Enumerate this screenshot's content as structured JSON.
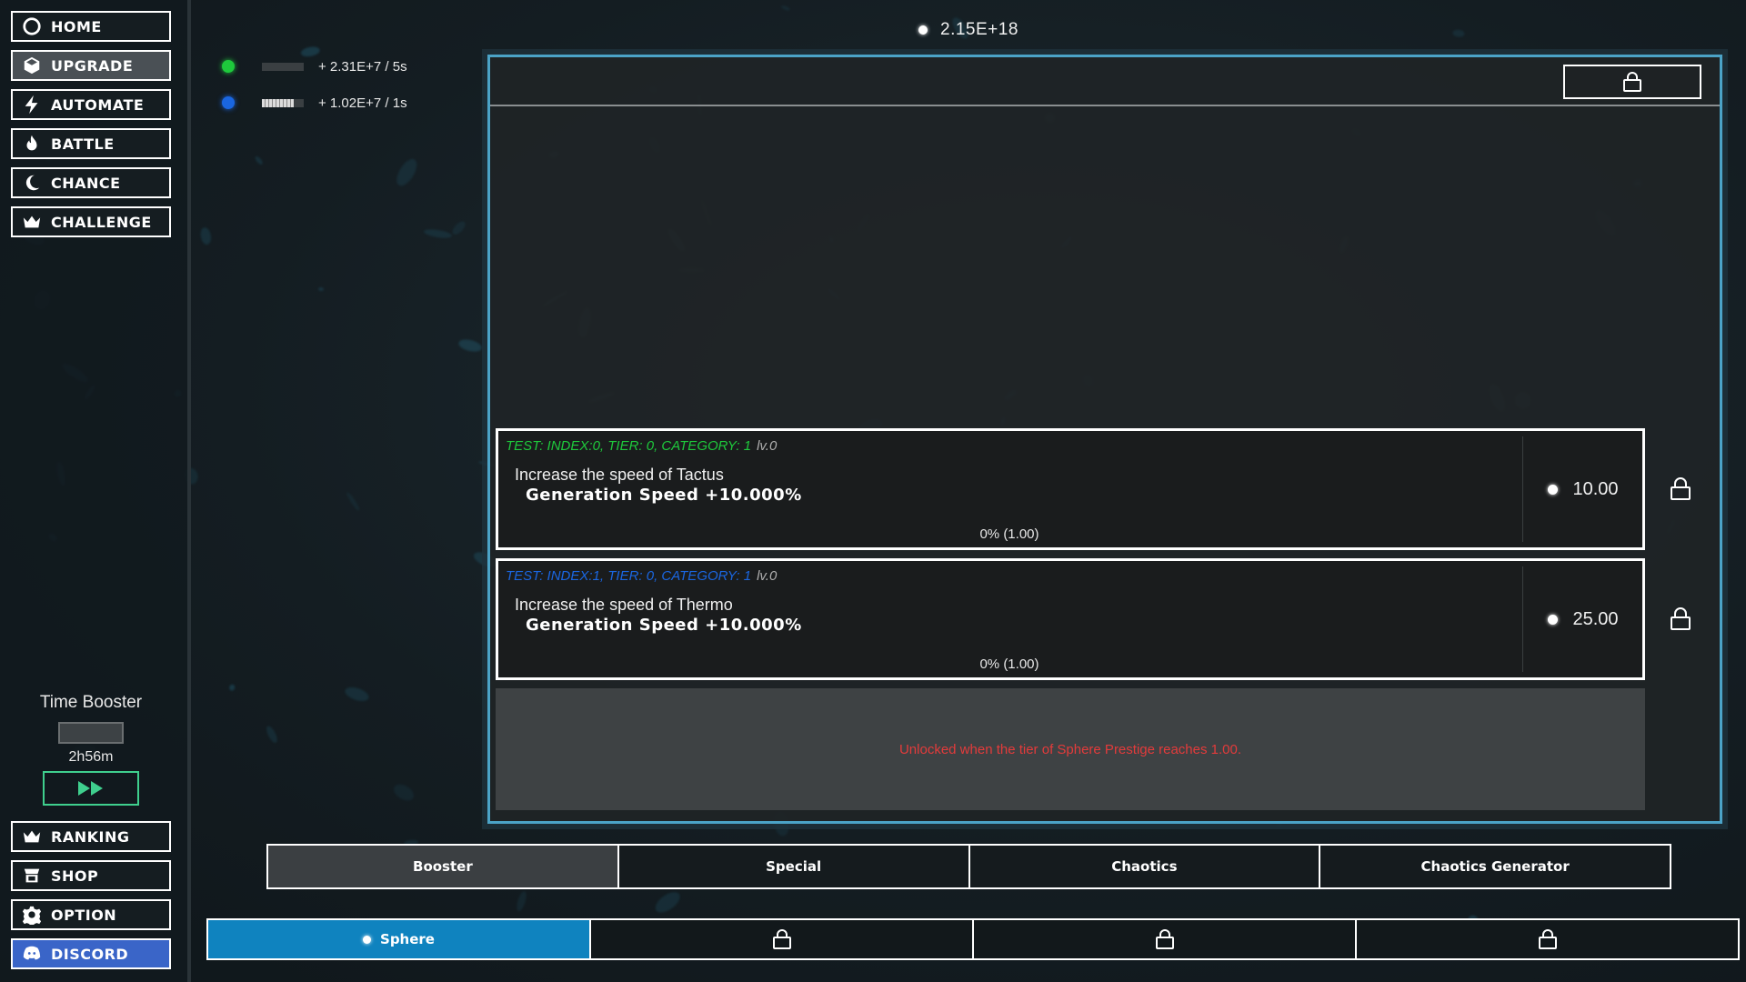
{
  "sidebar": {
    "top_items": [
      {
        "label": "HOME",
        "icon": "circle-icon"
      },
      {
        "label": "UPGRADE",
        "icon": "cube-icon"
      },
      {
        "label": "AUTOMATE",
        "icon": "lightning-icon"
      },
      {
        "label": "BATTLE",
        "icon": "flame-icon"
      },
      {
        "label": "CHANCE",
        "icon": "moon-icon"
      },
      {
        "label": "CHALLENGE",
        "icon": "crown-icon"
      }
    ],
    "bottom_items": [
      {
        "label": "RANKING",
        "icon": "crown-icon"
      },
      {
        "label": "SHOP",
        "icon": "shop-icon"
      },
      {
        "label": "OPTION",
        "icon": "gear-icon"
      },
      {
        "label": "DISCORD",
        "icon": "discord-icon"
      }
    ],
    "active": "UPGRADE",
    "time_booster": {
      "title": "Time Booster",
      "remaining": "2h56m"
    }
  },
  "generators": [
    {
      "rate": "+ 2.31E+7 / 5s",
      "color": "#1ec93c",
      "progress": 0.0
    },
    {
      "rate": "+ 1.02E+7 / 1s",
      "color": "#1a66e0",
      "progress": 0.75
    }
  ],
  "currency": {
    "value": "2.15E+18"
  },
  "upgrades": [
    {
      "test_label": "TEST: INDEX:0, TIER: 0, CATEGORY: 1",
      "test_color": "#1ec93c",
      "level": "lv.0",
      "description": "Increase the speed of Tactus",
      "effect": "Generation Speed +10.000%",
      "progress": "0% (1.00)",
      "cost": "10.00"
    },
    {
      "test_label": "TEST: INDEX:1, TIER: 0, CATEGORY: 1",
      "test_color": "#1a66e0",
      "level": "lv.0",
      "description": "Increase the speed of Thermo",
      "effect": "Generation Speed +10.000%",
      "progress": "0% (1.00)",
      "cost": "25.00"
    }
  ],
  "locked_message": "Unlocked when the tier of Sphere Prestige reaches 1.00.",
  "sub_tabs": [
    {
      "label": "Booster",
      "active": true
    },
    {
      "label": "Special",
      "active": false
    },
    {
      "label": "Chaotics",
      "active": false
    },
    {
      "label": "Chaotics Generator",
      "active": false
    }
  ],
  "bottom_tabs": [
    {
      "label": "Sphere",
      "active": true,
      "locked": false
    },
    {
      "label": "",
      "active": false,
      "locked": true
    },
    {
      "label": "",
      "active": false,
      "locked": true
    },
    {
      "label": "",
      "active": false,
      "locked": true
    }
  ]
}
